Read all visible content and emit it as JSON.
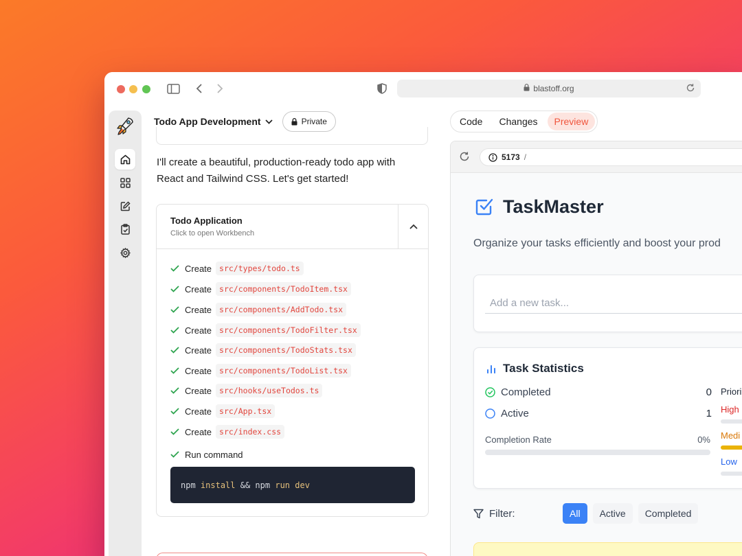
{
  "browser": {
    "url": "blastoff.org"
  },
  "rail": {
    "items": [
      {
        "icon": "home-icon",
        "active": true
      },
      {
        "icon": "grid-icon",
        "active": false
      },
      {
        "icon": "edit-icon",
        "active": false
      },
      {
        "icon": "clipboard-check-icon",
        "active": false
      },
      {
        "icon": "gear-icon",
        "active": false
      }
    ]
  },
  "chat": {
    "project_title": "Todo App Development",
    "private_label": "Private",
    "message_line1": "I'll create a beautiful, production-ready todo app with",
    "message_line2": "React and Tailwind CSS. Let's get started!",
    "artifact": {
      "title": "Todo Application",
      "subtitle": "Click to open Workbench",
      "steps": [
        {
          "action": "Create",
          "path": "src/types/todo.ts"
        },
        {
          "action": "Create",
          "path": "src/components/TodoItem.tsx"
        },
        {
          "action": "Create",
          "path": "src/components/AddTodo.tsx"
        },
        {
          "action": "Create",
          "path": "src/components/TodoFilter.tsx"
        },
        {
          "action": "Create",
          "path": "src/components/TodoStats.tsx"
        },
        {
          "action": "Create",
          "path": "src/components/TodoList.tsx"
        },
        {
          "action": "Create",
          "path": "src/hooks/useTodos.ts"
        },
        {
          "action": "Create",
          "path": "src/App.tsx"
        },
        {
          "action": "Create",
          "path": "src/index.css"
        }
      ],
      "run_label": "Run command",
      "command": {
        "t1": "npm",
        "t2": "install",
        "t3": "&&",
        "t4": "npm",
        "t5": "run",
        "t6": "dev"
      }
    }
  },
  "workbench": {
    "tabs": [
      "Code",
      "Changes",
      "Preview"
    ],
    "active_tab": "Preview",
    "preview_port": "5173",
    "preview_path": "/"
  },
  "app": {
    "title": "TaskMaster",
    "subtitle": "Organize your tasks efficiently and boost your prod",
    "add_placeholder": "Add a new task...",
    "stats": {
      "title": "Task Statistics",
      "completed_label": "Completed",
      "completed_value": "0",
      "active_label": "Active",
      "active_value": "1",
      "rate_label": "Completion Rate",
      "rate_value": "0%",
      "rate_fraction": 0,
      "priority_title": "Priori",
      "priorities": [
        {
          "label": "High",
          "color": "#dc2626",
          "fill": 0
        },
        {
          "label": "Medi",
          "color": "#d97706",
          "fill": 1
        },
        {
          "label": "Low",
          "color": "#2563eb",
          "fill": 0
        }
      ]
    },
    "filter": {
      "label": "Filter:",
      "options": [
        "All",
        "Active",
        "Completed"
      ],
      "active": "All"
    }
  },
  "colors": {
    "accent": "#f0553c",
    "app_blue": "#3b82f6",
    "success": "#2ea44f"
  }
}
